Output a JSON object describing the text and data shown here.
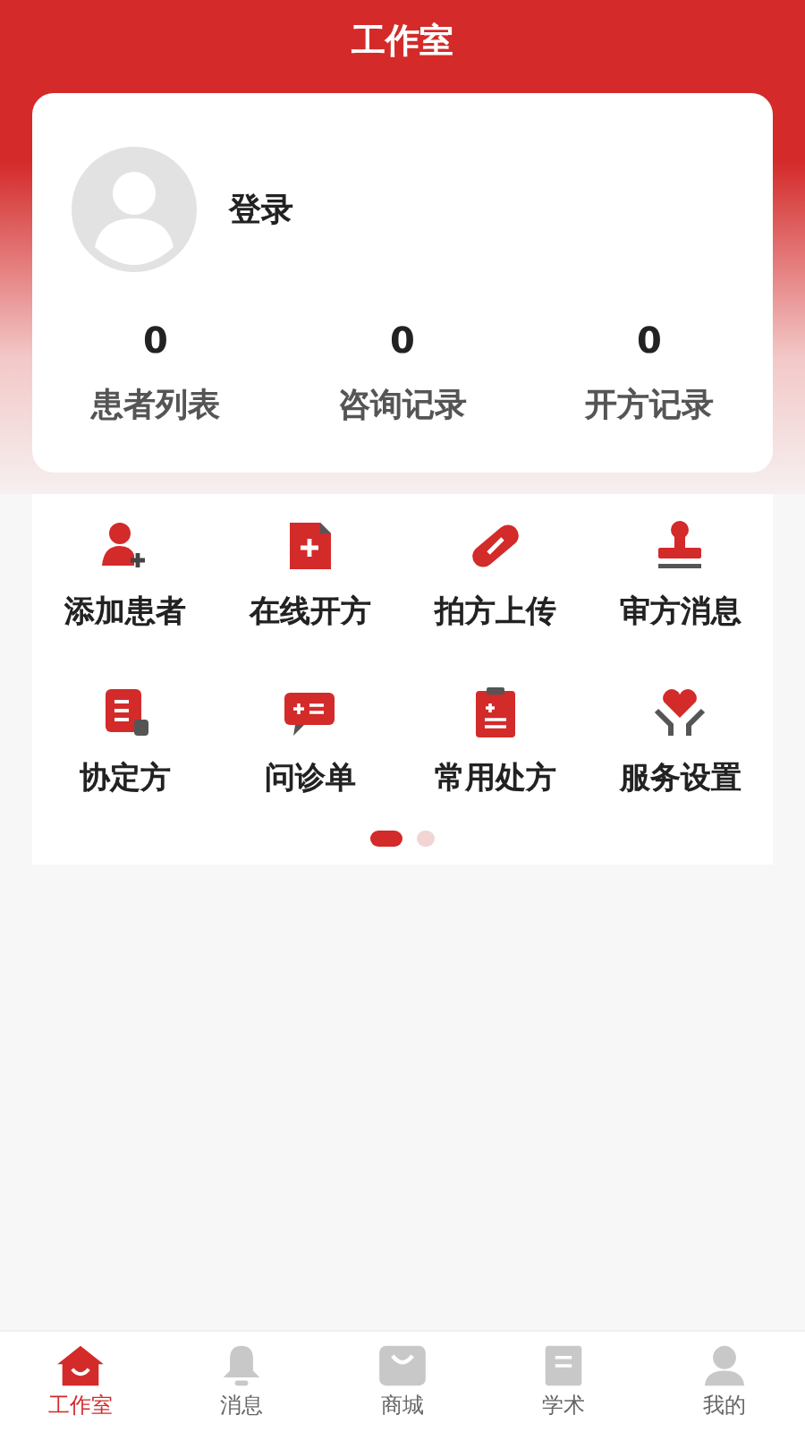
{
  "header": {
    "title": "工作室"
  },
  "profile": {
    "login": "登录"
  },
  "stats": [
    {
      "value": "0",
      "label": "患者列表"
    },
    {
      "value": "0",
      "label": "咨询记录"
    },
    {
      "value": "0",
      "label": "开方记录"
    }
  ],
  "shortcuts": [
    "添加患者",
    "在线开方",
    "拍方上传",
    "审方消息",
    "协定方",
    "问诊单",
    "常用处方",
    "服务设置"
  ],
  "pager": [
    {
      "selected": true
    },
    {
      "selected": false
    }
  ],
  "tabbar": [
    {
      "label": "工作室",
      "selected": true
    },
    {
      "label": "消息",
      "selected": false
    },
    {
      "label": "商城",
      "selected": false
    },
    {
      "label": "学术",
      "selected": false
    },
    {
      "label": "我的",
      "selected": false
    }
  ]
}
